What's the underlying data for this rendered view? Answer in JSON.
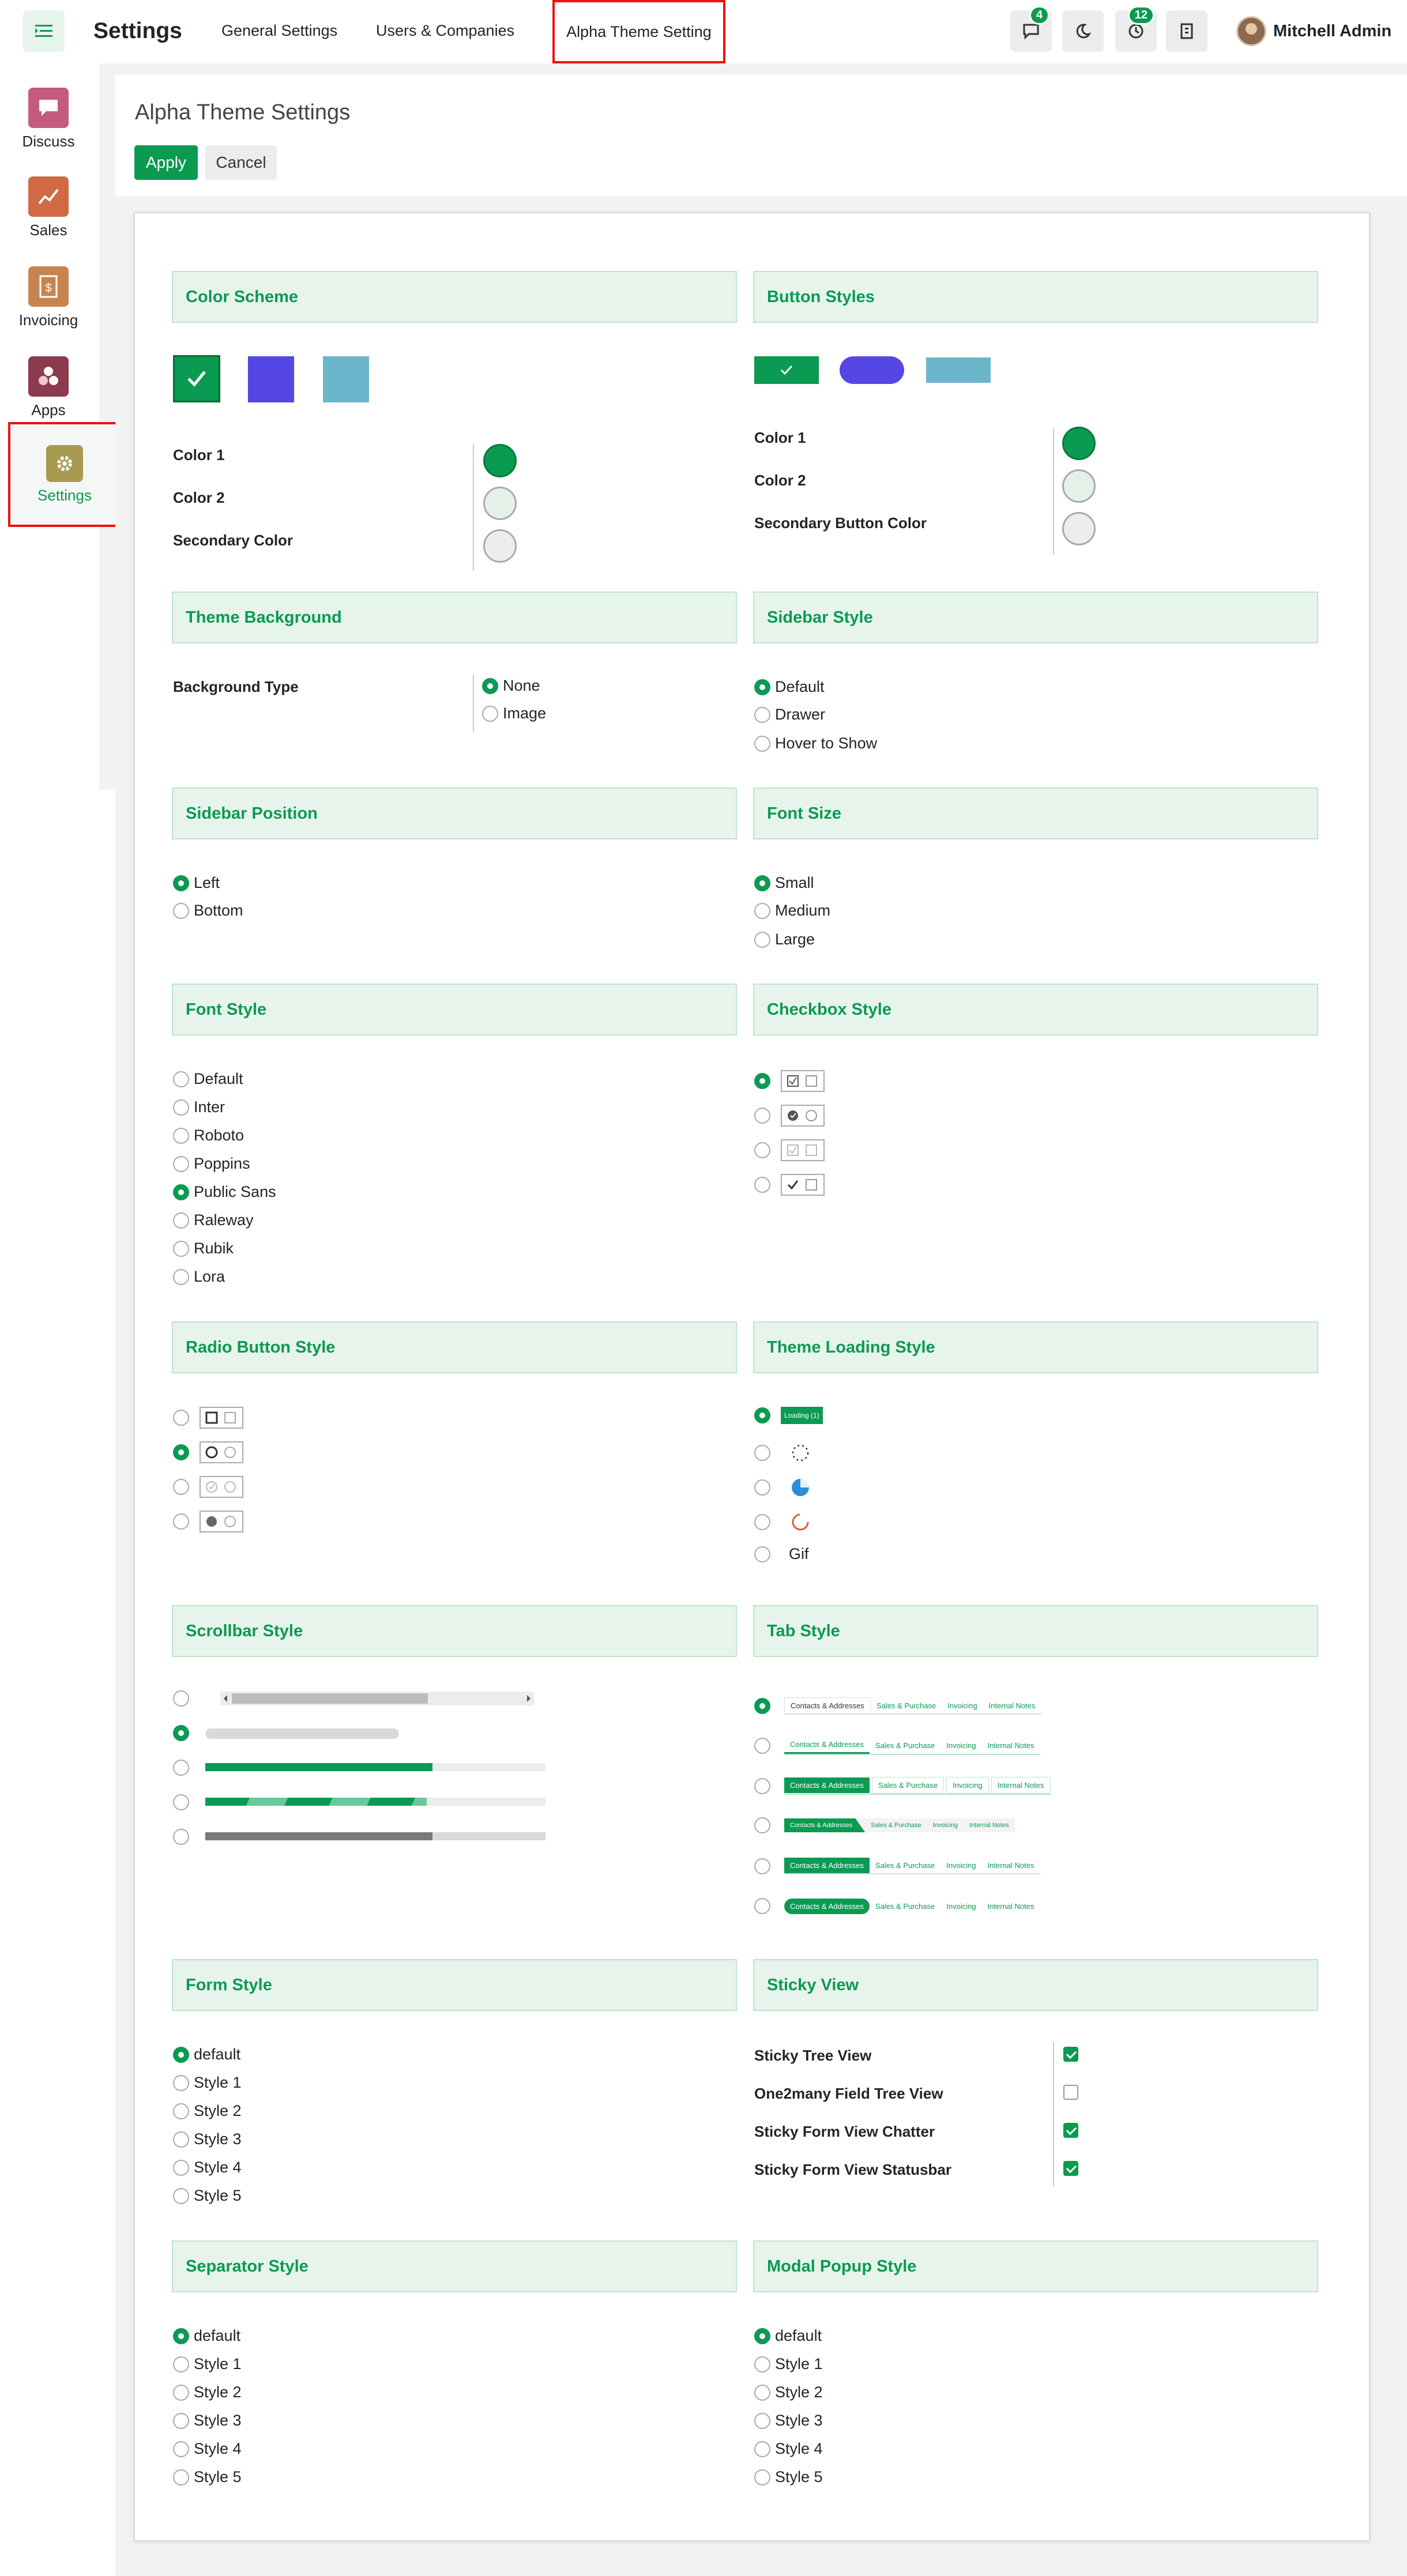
{
  "topbar": {
    "app_title": "Settings",
    "nav": [
      "General Settings",
      "Users & Companies",
      "Alpha Theme Setting"
    ],
    "chat_badge": "4",
    "activity_badge": "12",
    "user_name": "Mitchell Admin"
  },
  "sidebar": {
    "items": [
      {
        "label": "Discuss",
        "color": "#c45a7f"
      },
      {
        "label": "Sales",
        "color": "#cf6a45"
      },
      {
        "label": "Invoicing",
        "color": "#c8844e"
      },
      {
        "label": "Apps",
        "color": "#8e3a4e"
      },
      {
        "label": "Settings",
        "color": "#a89a4e"
      }
    ]
  },
  "control": {
    "breadcrumb": "Alpha Theme Settings",
    "apply": "Apply",
    "cancel": "Cancel"
  },
  "colors": {
    "accent": "#0b9a52",
    "blue": "#5547e4",
    "teal": "#6cb6cb"
  },
  "sections": {
    "color_scheme": {
      "title": "Color Scheme",
      "rows": [
        "Color 1",
        "Color 2",
        "Secondary Color"
      ]
    },
    "button_styles": {
      "title": "Button Styles",
      "rows": [
        "Color 1",
        "Color 2",
        "Secondary Button Color"
      ]
    },
    "theme_background": {
      "title": "Theme Background",
      "label": "Background Type",
      "options": [
        "None",
        "Image"
      ]
    },
    "sidebar_style": {
      "title": "Sidebar Style",
      "options": [
        "Default",
        "Drawer",
        "Hover to Show"
      ]
    },
    "sidebar_position": {
      "title": "Sidebar Position",
      "options": [
        "Left",
        "Bottom"
      ]
    },
    "font_size": {
      "title": "Font Size",
      "options": [
        "Small",
        "Medium",
        "Large"
      ]
    },
    "font_style": {
      "title": "Font Style",
      "options": [
        "Default",
        "Inter",
        "Roboto",
        "Poppins",
        "Public Sans",
        "Raleway",
        "Rubik",
        "Lora"
      ]
    },
    "checkbox_style": {
      "title": "Checkbox Style"
    },
    "radio_button_style": {
      "title": "Radio Button Style"
    },
    "theme_loading_style": {
      "title": "Theme Loading Style",
      "loading_label": "Loading (1)",
      "gif_label": "Gif"
    },
    "scrollbar_style": {
      "title": "Scrollbar Style"
    },
    "tab_style": {
      "title": "Tab Style",
      "tabs": [
        "Contacts & Addresses",
        "Sales & Purchase",
        "Invoicing",
        "Internal Notes"
      ]
    },
    "form_style": {
      "title": "Form Style",
      "options": [
        "default",
        "Style 1",
        "Style 2",
        "Style 3",
        "Style 4",
        "Style 5"
      ]
    },
    "sticky_view": {
      "title": "Sticky View",
      "rows": [
        "Sticky Tree View",
        "One2many Field Tree View",
        "Sticky Form View Chatter",
        "Sticky Form View Statusbar"
      ]
    },
    "separator_style": {
      "title": "Separator Style",
      "options": [
        "default",
        "Style 1",
        "Style 2",
        "Style 3",
        "Style 4",
        "Style 5"
      ]
    },
    "modal_popup_style": {
      "title": "Modal Popup Style",
      "options": [
        "default",
        "Style 1",
        "Style 2",
        "Style 3",
        "Style 4",
        "Style 5"
      ]
    }
  }
}
